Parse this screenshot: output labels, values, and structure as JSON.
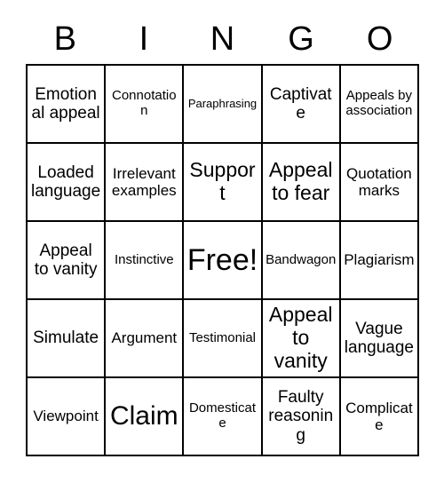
{
  "card": {
    "title_letters": [
      "B",
      "I",
      "N",
      "G",
      "O"
    ],
    "columns": 5,
    "rows": 5,
    "free_space_label": "Free!",
    "free_space_position": "center",
    "border_color": "#000000",
    "background_color": "#ffffff",
    "text_color": "#000000"
  },
  "grid": {
    "rows": [
      {
        "cells": [
          {
            "label": "Emotional appeal",
            "size": "l"
          },
          {
            "label": "Connotation",
            "size": "s"
          },
          {
            "label": "Paraphrasing",
            "size": "xs"
          },
          {
            "label": "Captivate",
            "size": "l"
          },
          {
            "label": "Appeals by association",
            "size": "s"
          }
        ]
      },
      {
        "cells": [
          {
            "label": "Loaded language",
            "size": "l"
          },
          {
            "label": "Irrelevant examples",
            "size": "m"
          },
          {
            "label": "Support",
            "size": "xl"
          },
          {
            "label": "Appeal to fear",
            "size": "xl"
          },
          {
            "label": "Quotation marks",
            "size": "m"
          }
        ]
      },
      {
        "cells": [
          {
            "label": "Appeal to vanity",
            "size": "l"
          },
          {
            "label": "Instinctive",
            "size": "s"
          },
          {
            "label": "Free!",
            "size": "free"
          },
          {
            "label": "Bandwagon",
            "size": "s"
          },
          {
            "label": "Plagiarism",
            "size": "m"
          }
        ]
      },
      {
        "cells": [
          {
            "label": "Simulate",
            "size": "l"
          },
          {
            "label": "Argument",
            "size": "m"
          },
          {
            "label": "Testimonial",
            "size": "s"
          },
          {
            "label": "Appeal to vanity",
            "size": "xl"
          },
          {
            "label": "Vague language",
            "size": "l"
          }
        ]
      },
      {
        "cells": [
          {
            "label": "Viewpoint",
            "size": "m"
          },
          {
            "label": "Claim",
            "size": "xxl"
          },
          {
            "label": "Domesticate",
            "size": "s"
          },
          {
            "label": "Faulty reasoning",
            "size": "l"
          },
          {
            "label": "Complicate",
            "size": "m"
          }
        ]
      }
    ]
  }
}
